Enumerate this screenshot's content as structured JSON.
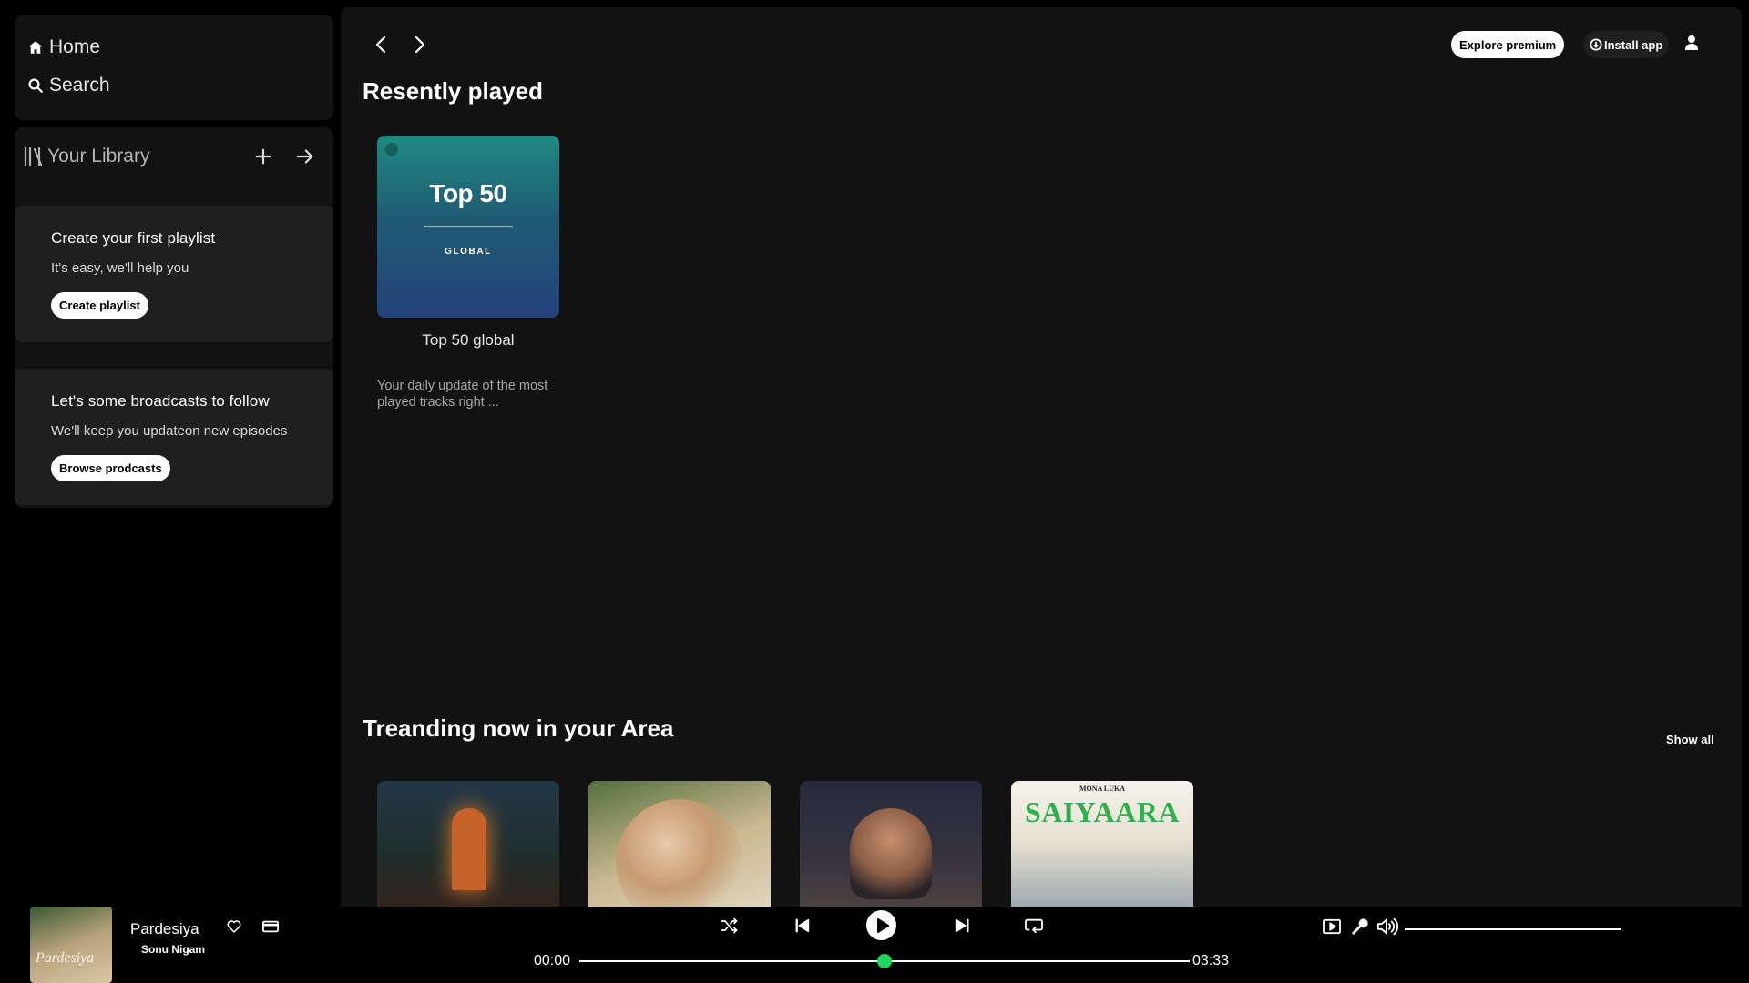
{
  "nav": {
    "home_label": "Home",
    "search_label": "Search"
  },
  "library": {
    "title": "Your Library",
    "playlist_card": {
      "heading": "Create your first playlist",
      "text": "It's easy, we'll help you",
      "button": "Create playlist"
    },
    "podcast_card": {
      "heading": "Let's some broadcasts to follow",
      "text": "We'll keep you updateon new episodes",
      "button": "Browse prodcasts"
    }
  },
  "header": {
    "explore_label": "Explore premium",
    "install_label": "Install app"
  },
  "recent": {
    "title": "Resently played",
    "items": [
      {
        "cover_big": "Top 50",
        "cover_sub": "GLOBAL",
        "title": "Top 50 global",
        "description": "Your daily update of the most played tracks right ..."
      }
    ]
  },
  "trending": {
    "title": "Treanding now in your Area",
    "show_all": "Show all",
    "covers": [
      {
        "name": "trend-cover-1"
      },
      {
        "name": "trend-cover-2"
      },
      {
        "name": "trend-cover-3"
      },
      {
        "name": "trend-cover-4",
        "top_text": "MONA LUKA",
        "big_text": "SAIYAARA"
      }
    ]
  },
  "player": {
    "cover_text": "Pardesiya",
    "song_title": "Pardesiya",
    "artist": "Sonu Nigam",
    "time_current": "00:00",
    "time_total": "03:33",
    "progress_fraction": 0.5,
    "volume_fraction": 1.0,
    "accent_color": "#1ed760",
    "icons": [
      "heart-icon",
      "device-icon",
      "shuffle-icon",
      "previous-icon",
      "play-icon",
      "next-icon",
      "repeat-icon",
      "now-playing-view-icon",
      "microphone-icon",
      "volume-icon"
    ]
  }
}
